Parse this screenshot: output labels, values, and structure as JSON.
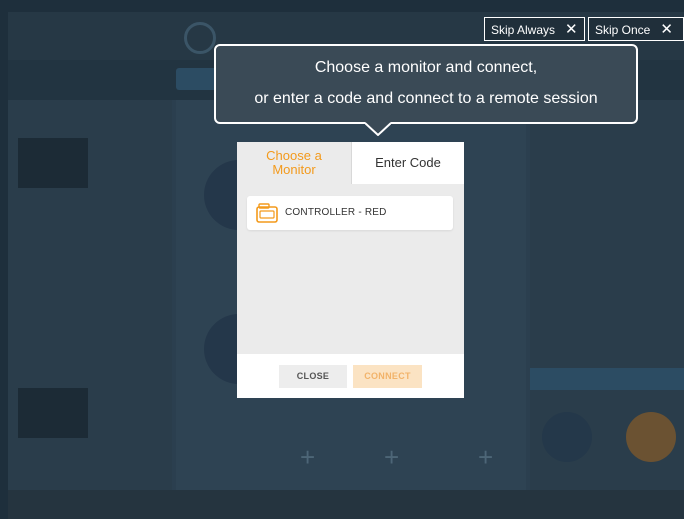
{
  "skip": {
    "always_label": "Skip Always",
    "once_label": "Skip Once",
    "close_glyph": "✕"
  },
  "tooltip": {
    "line1": "Choose a monitor and connect,",
    "line2": "or enter a code and connect to a remote session"
  },
  "dialog": {
    "tabs": [
      {
        "label_line1": "Choose a",
        "label_line2": "Monitor",
        "active": true
      },
      {
        "label": "Enter Code",
        "active": false
      }
    ],
    "monitors": [
      {
        "label": "CONTROLLER - RED",
        "icon": "monitor-device-icon"
      }
    ],
    "buttons": {
      "close": "CLOSE",
      "connect": "CONNECT"
    }
  },
  "colors": {
    "accent": "#f39a1c",
    "connect_bg": "#fbe3c3",
    "overlay": "#2b3f4f"
  }
}
